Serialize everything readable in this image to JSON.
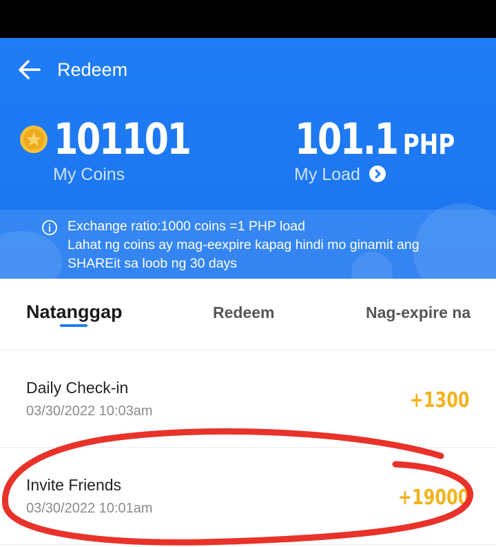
{
  "header": {
    "title": "Redeem"
  },
  "summary": {
    "coins_value": "101101",
    "coins_label": "My Coins",
    "load_value": "101.1",
    "load_currency": "PHP",
    "load_label": "My Load"
  },
  "info": {
    "line1": "Exchange ratio:1000 coins =1 PHP load",
    "line2": "Lahat ng coins ay mag-eexpire kapag hindi mo ginamit ang",
    "line3": "SHAREit sa loob ng 30 days"
  },
  "tabs": [
    {
      "label": "Natanggap",
      "active": true
    },
    {
      "label": "Redeem",
      "active": false
    },
    {
      "label": "Nag-expire na",
      "active": false
    }
  ],
  "records": [
    {
      "title": "Daily Check-in",
      "date": "03/30/2022 10:03am",
      "amount": "+1300"
    },
    {
      "title": "Invite Friends",
      "date": "03/30/2022 10:01am",
      "amount": "+19000"
    }
  ],
  "colors": {
    "header_blue": "#1f7df6",
    "amount_gold": "#f2b21c",
    "annotation_red": "#e8322a"
  }
}
